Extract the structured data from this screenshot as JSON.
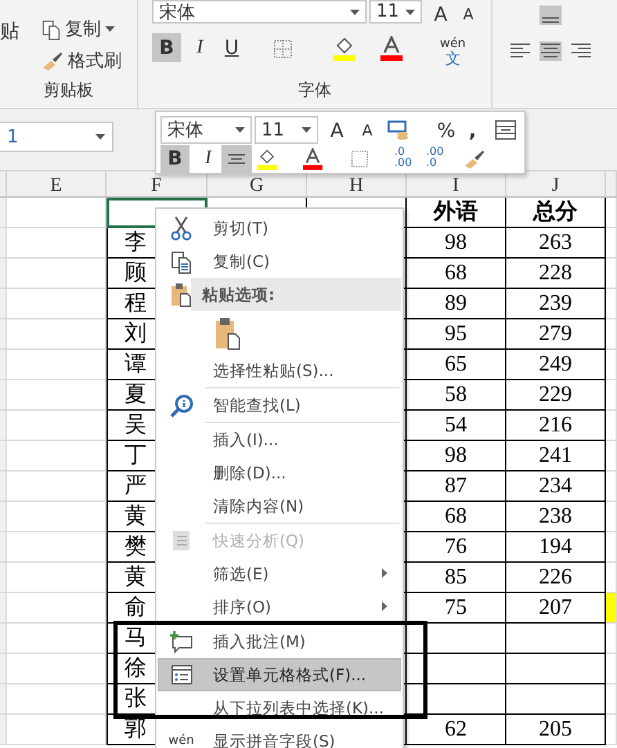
{
  "ribbon": {
    "clipboard": {
      "paste": "贴",
      "copy": "复制",
      "format_painter": "格式刷",
      "label": "剪贴板"
    },
    "font": {
      "family": "宋体",
      "size": "11",
      "grow": "A",
      "shrink": "A",
      "bold": "B",
      "italic": "I",
      "underline": "U",
      "pinyin_top": "wén",
      "pinyin_bottom": "文",
      "label": "字体",
      "bold_on": true
    }
  },
  "name_box": {
    "value": "1"
  },
  "mini_toolbar": {
    "font": "宋体",
    "size": "11",
    "grow": "A",
    "shrink": "A",
    "percent": "%",
    "comma": ",",
    "bold": "B",
    "italic": "I",
    "decimal_more": [
      ".0",
      ".00"
    ],
    "decimal_less": [
      ".00",
      ".0"
    ]
  },
  "columns": [
    "E",
    "F",
    "G",
    "H",
    "I",
    "J"
  ],
  "rows": [
    {
      "name": "",
      "foreign": "外语",
      "total": "总分",
      "selected": true,
      "highlight": false,
      "header": true
    },
    {
      "name": "李",
      "foreign": "98",
      "total": "263",
      "selected": false,
      "highlight": false,
      "header": false
    },
    {
      "name": "顾",
      "foreign": "68",
      "total": "228",
      "selected": false,
      "highlight": false,
      "header": false
    },
    {
      "name": "程",
      "foreign": "89",
      "total": "239",
      "selected": false,
      "highlight": false,
      "header": false
    },
    {
      "name": "刘",
      "foreign": "95",
      "total": "279",
      "selected": false,
      "highlight": false,
      "header": false
    },
    {
      "name": "谭",
      "foreign": "65",
      "total": "249",
      "selected": false,
      "highlight": false,
      "header": false
    },
    {
      "name": "夏",
      "foreign": "58",
      "total": "229",
      "selected": false,
      "highlight": false,
      "header": false
    },
    {
      "name": "吴",
      "foreign": "54",
      "total": "216",
      "selected": false,
      "highlight": false,
      "header": false
    },
    {
      "name": "丁",
      "foreign": "98",
      "total": "241",
      "selected": false,
      "highlight": false,
      "header": false
    },
    {
      "name": "严",
      "foreign": "87",
      "total": "234",
      "selected": false,
      "highlight": false,
      "header": false
    },
    {
      "name": "黄",
      "foreign": "68",
      "total": "238",
      "selected": false,
      "highlight": false,
      "header": false
    },
    {
      "name": "樊",
      "foreign": "76",
      "total": "194",
      "selected": false,
      "highlight": false,
      "header": false
    },
    {
      "name": "黄",
      "foreign": "85",
      "total": "226",
      "selected": false,
      "highlight": false,
      "header": false
    },
    {
      "name": "俞",
      "foreign": "75",
      "total": "207",
      "selected": false,
      "highlight": true,
      "header": false
    },
    {
      "name": "马",
      "selected": false,
      "highlight": false,
      "header": false
    },
    {
      "name": "徐",
      "selected": false,
      "highlight": false,
      "header": false
    },
    {
      "name": "张",
      "selected": false,
      "highlight": false,
      "header": false
    },
    {
      "name": "郭",
      "foreign": "62",
      "total": "205",
      "selected": false,
      "highlight": false,
      "header": false
    }
  ],
  "context_menu": {
    "items": [
      {
        "kind": "cut",
        "label": "剪切(T)",
        "selected": false,
        "disabled": false,
        "submenu": false
      },
      {
        "kind": "copy",
        "label": "复制(C)",
        "selected": false,
        "disabled": false,
        "submenu": false
      },
      {
        "kind": "header",
        "label": "粘贴选项:"
      },
      {
        "kind": "paste"
      },
      {
        "kind": "plain",
        "label": "选择性粘贴(S)...",
        "selected": false,
        "disabled": false,
        "submenu": false
      },
      {
        "kind": "separator"
      },
      {
        "kind": "lookup",
        "label": "智能查找(L)",
        "selected": false,
        "disabled": false,
        "submenu": false
      },
      {
        "kind": "separator"
      },
      {
        "kind": "plain",
        "label": "插入(I)...",
        "selected": false,
        "disabled": false,
        "submenu": false
      },
      {
        "kind": "plain",
        "label": "删除(D)...",
        "selected": false,
        "disabled": false,
        "submenu": false
      },
      {
        "kind": "plain",
        "label": "清除内容(N)",
        "selected": false,
        "disabled": false,
        "submenu": false
      },
      {
        "kind": "separator"
      },
      {
        "kind": "analysis",
        "label": "快速分析(Q)",
        "selected": false,
        "disabled": true,
        "submenu": false
      },
      {
        "kind": "plain",
        "label": "筛选(E)",
        "selected": false,
        "disabled": false,
        "submenu": true
      },
      {
        "kind": "plain",
        "label": "排序(O)",
        "selected": false,
        "disabled": false,
        "submenu": true
      },
      {
        "kind": "separator"
      },
      {
        "kind": "comment",
        "label": "插入批注(M)",
        "selected": false,
        "disabled": false,
        "submenu": false
      },
      {
        "kind": "format",
        "label": "设置单元格格式(F)...",
        "selected": true,
        "disabled": false,
        "submenu": false
      },
      {
        "kind": "plain",
        "label": "从下拉列表中选择(K)...",
        "selected": false,
        "disabled": false,
        "submenu": false
      },
      {
        "kind": "pinyin",
        "label": "显示拼音字段(S)",
        "icon_text": "wén",
        "selected": false,
        "disabled": false,
        "submenu": false
      }
    ]
  }
}
